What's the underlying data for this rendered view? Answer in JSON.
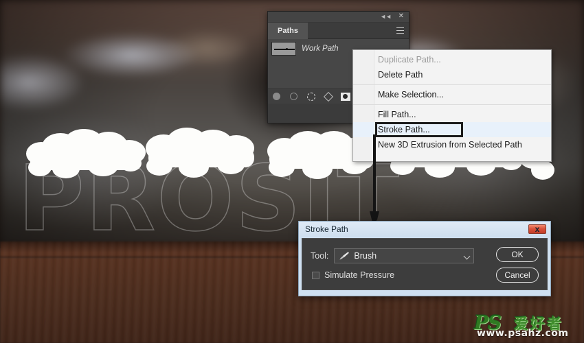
{
  "artwork": {
    "headline_text": "PROSIT",
    "scene_description": "blurred-pub-background",
    "table_description": "dark-wood-table"
  },
  "paths_panel": {
    "tab_label": "Paths",
    "collapse_icon": "double-chevron-left-icon",
    "close_icon": "close-icon",
    "menu_icon": "panel-menu-icon",
    "rows": [
      {
        "name": "Work Path",
        "thumbnail": "path-thumbnail"
      }
    ],
    "footer_buttons": [
      {
        "icon": "fill-path-with-foreground-color-icon"
      },
      {
        "icon": "stroke-path-with-brush-icon"
      },
      {
        "icon": "load-path-as-selection-icon"
      },
      {
        "icon": "make-work-path-from-selection-icon"
      },
      {
        "icon": "add-layer-mask-icon"
      }
    ]
  },
  "context_menu": {
    "items": [
      {
        "label": "Duplicate Path...",
        "disabled": true,
        "highlighted": false,
        "separator_after": false
      },
      {
        "label": "Delete Path",
        "disabled": false,
        "highlighted": false,
        "separator_after": true
      },
      {
        "label": "Make Selection...",
        "disabled": false,
        "highlighted": false,
        "separator_after": true
      },
      {
        "label": "Fill Path...",
        "disabled": false,
        "highlighted": false,
        "separator_after": false
      },
      {
        "label": "Stroke Path...",
        "disabled": false,
        "highlighted": true,
        "separator_after": false
      },
      {
        "label": "New 3D Extrusion from Selected Path",
        "disabled": false,
        "highlighted": false,
        "separator_after": false
      }
    ]
  },
  "annotation": {
    "arrow": "down-arrow-annotation"
  },
  "stroke_dialog": {
    "title": "Stroke Path",
    "close_label": "x",
    "tool_label": "Tool:",
    "tool_value": "Brush",
    "tool_icon": "brush-icon",
    "dropdown_icon": "chevron-down-icon",
    "simulate_pressure_label": "Simulate Pressure",
    "simulate_pressure_checked": false,
    "ok_label": "OK",
    "cancel_label": "Cancel"
  },
  "watermark": {
    "ps_text": "PS",
    "cn_text": "爱好者",
    "url_text": "www.psahz.com"
  },
  "colors": {
    "beer_gold": "#f5b120",
    "foam_white": "#fdfdfb",
    "panel_gray": "#3b3b3b",
    "menu_highlight": "#e8f1fb",
    "dialog_titlebar": "#cfdfef",
    "dialog_body": "#3d3d3d",
    "close_red": "#d9503a",
    "watermark_green": "#2f7a22"
  }
}
